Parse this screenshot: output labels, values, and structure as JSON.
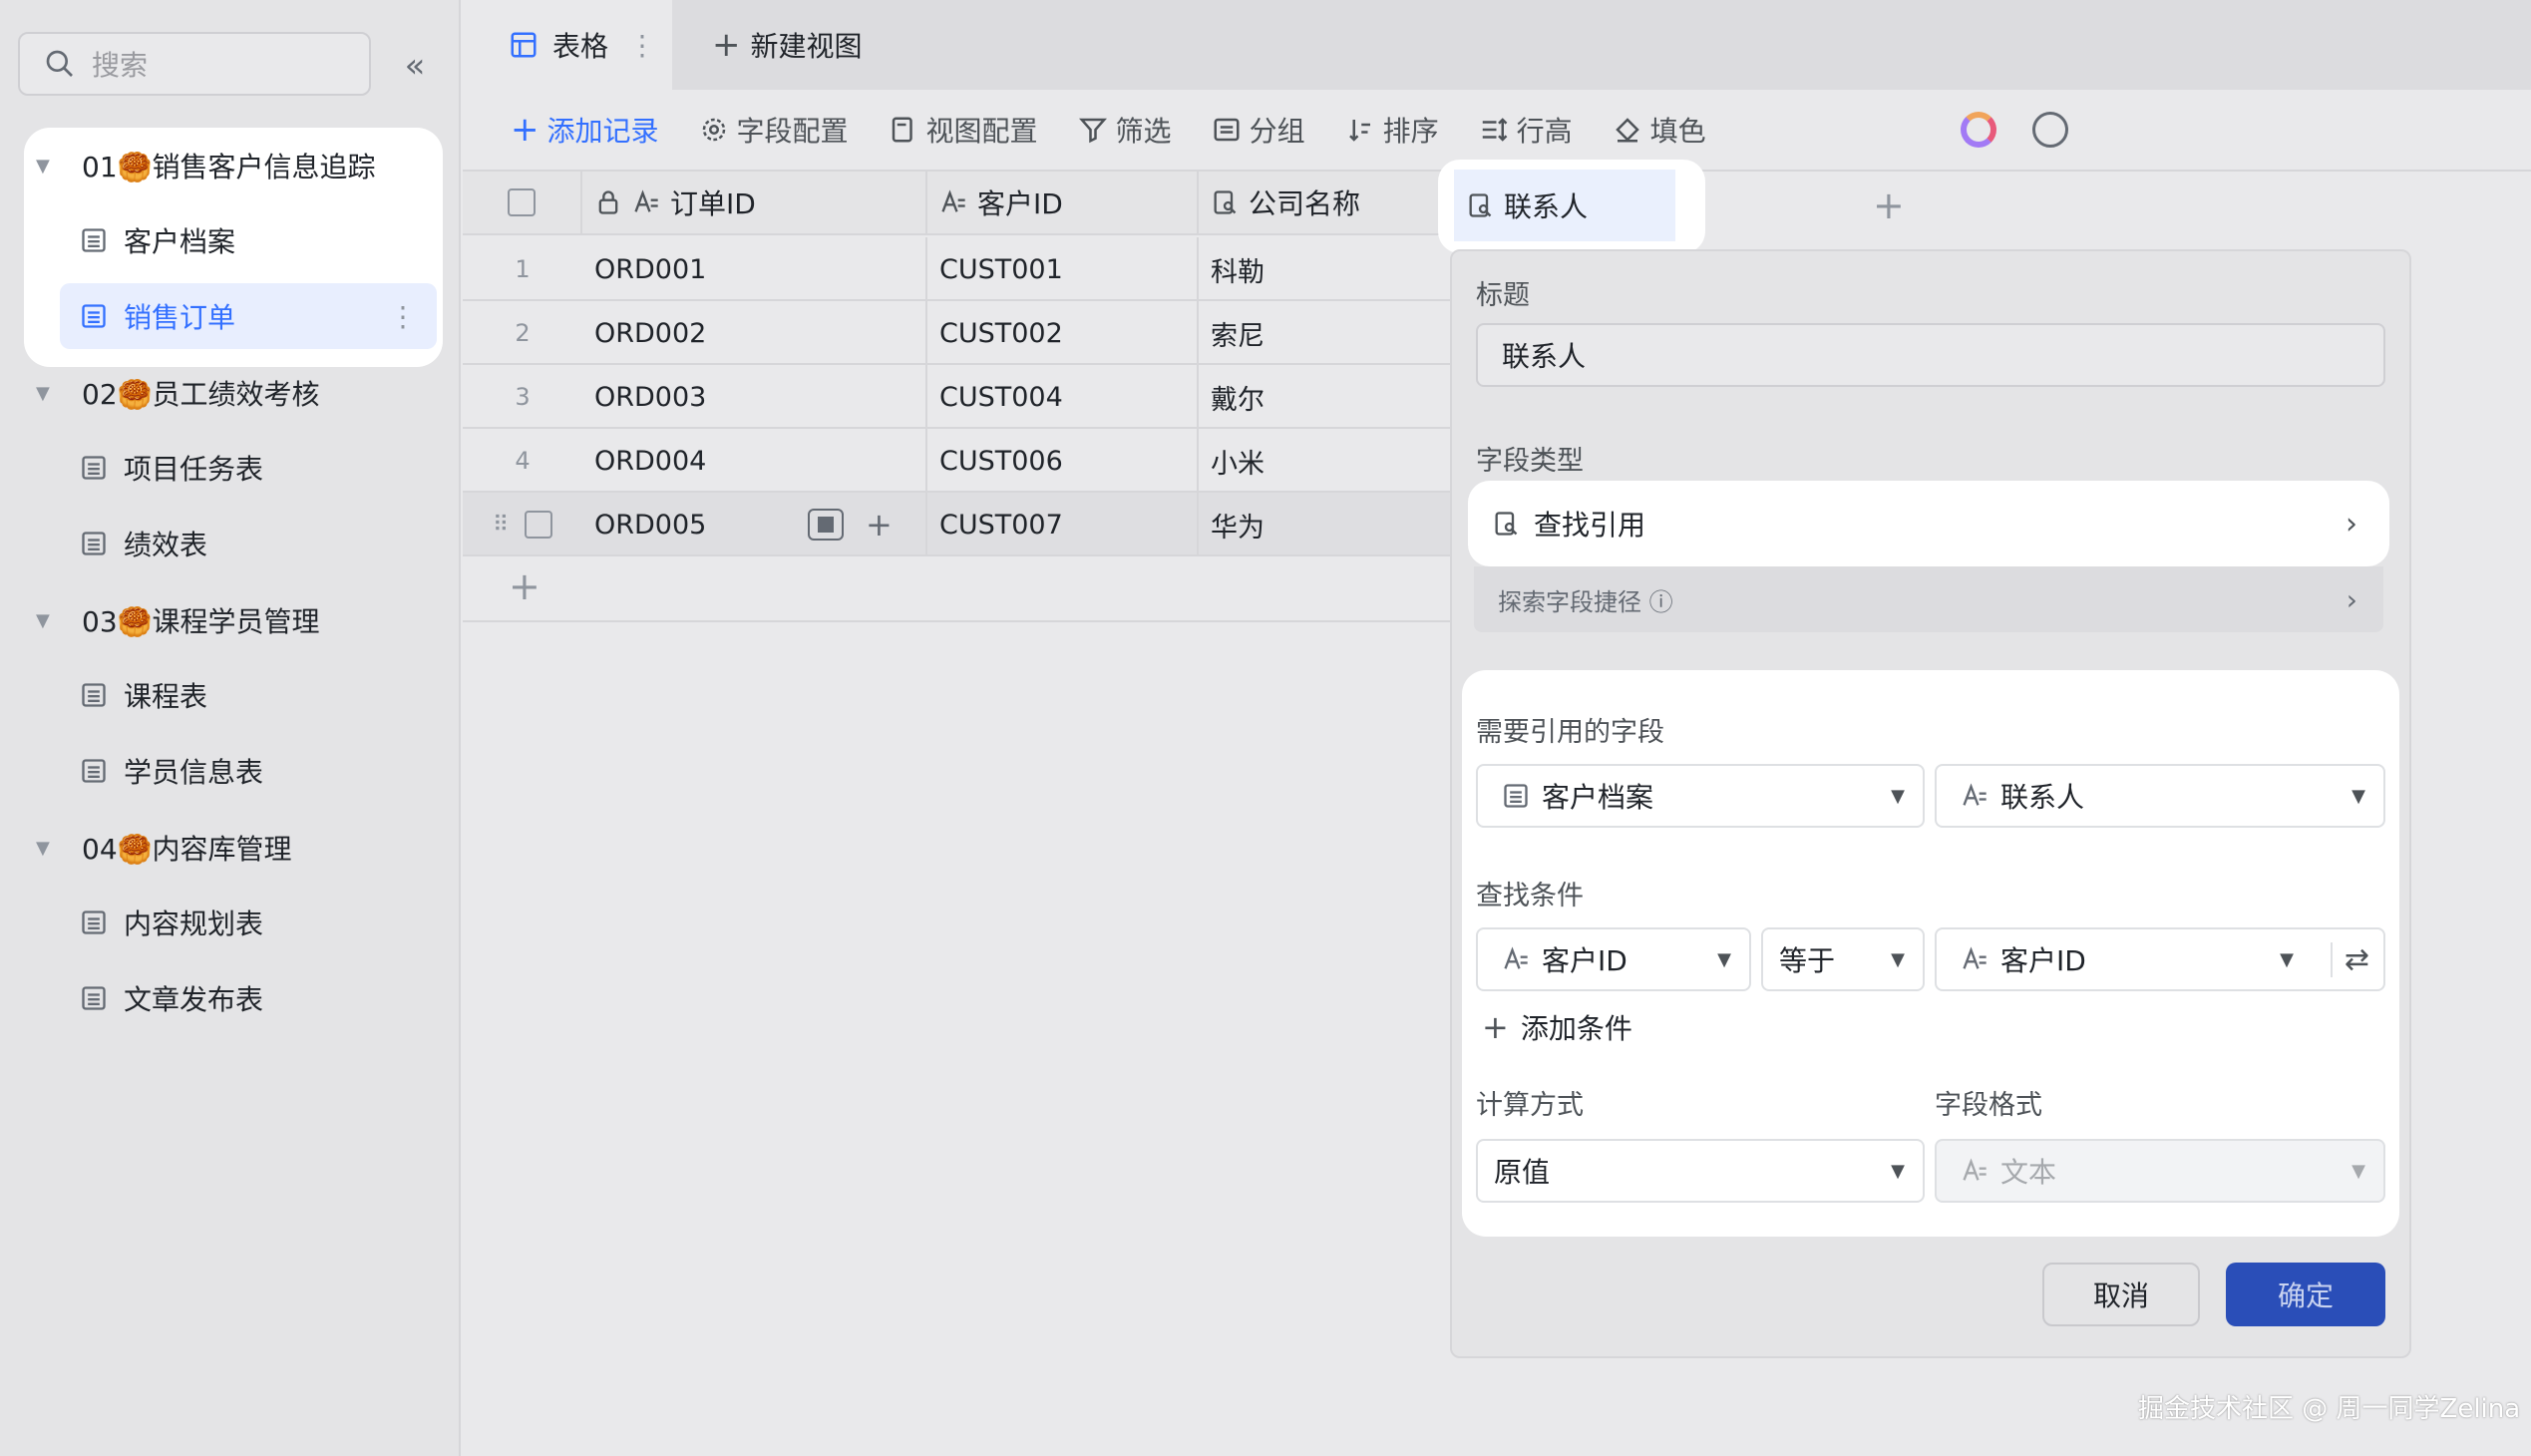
{
  "sidebar": {
    "search_placeholder": "搜索",
    "collapse_icon": "«",
    "groups": [
      {
        "label": "01🥮销售客户信息追踪",
        "items": [
          "客户档案",
          "销售订单"
        ]
      },
      {
        "label": "02🥮员工绩效考核",
        "items": [
          "项目任务表",
          "绩效表"
        ]
      },
      {
        "label": "03🥮课程学员管理",
        "items": [
          "课程表",
          "学员信息表"
        ]
      },
      {
        "label": "04🥮内容库管理",
        "items": [
          "内容规划表",
          "文章发布表"
        ]
      }
    ],
    "active_item": "销售订单"
  },
  "tabs": {
    "active": "表格",
    "new_view": "新建视图"
  },
  "toolbar": {
    "add_record": "添加记录",
    "field_config": "字段配置",
    "view_config": "视图配置",
    "filter": "筛选",
    "group": "分组",
    "sort": "排序",
    "row_height": "行高",
    "fill": "填色"
  },
  "table": {
    "columns": [
      "订单ID",
      "客户ID",
      "公司名称",
      "联系人"
    ],
    "rows": [
      {
        "num": "1",
        "order": "ORD001",
        "customer": "CUST001",
        "company": "科勒"
      },
      {
        "num": "2",
        "order": "ORD002",
        "customer": "CUST002",
        "company": "索尼"
      },
      {
        "num": "3",
        "order": "ORD003",
        "customer": "CUST004",
        "company": "戴尔"
      },
      {
        "num": "4",
        "order": "ORD004",
        "customer": "CUST006",
        "company": "小米"
      },
      {
        "num": "",
        "order": "ORD005",
        "customer": "CUST007",
        "company": "华为"
      }
    ]
  },
  "panel": {
    "title_label": "标题",
    "title_value": "联系人",
    "type_label": "字段类型",
    "type_value": "查找引用",
    "shortcut": "探索字段捷径 ⓘ",
    "ref_label": "需要引用的字段",
    "ref_table": "客户档案",
    "ref_field": "联系人",
    "cond_label": "查找条件",
    "cond_field": "客户ID",
    "cond_op": "等于",
    "cond_target": "客户ID",
    "add_condition": "添加条件",
    "calc_label": "计算方式",
    "calc_value": "原值",
    "format_label": "字段格式",
    "format_value": "文本",
    "cancel": "取消",
    "confirm": "确定"
  },
  "footer": "掘金技术社区 @ 周一同学Zelina",
  "colors": {
    "accent": "#3370ff",
    "confirm": "#2a4eb8"
  }
}
